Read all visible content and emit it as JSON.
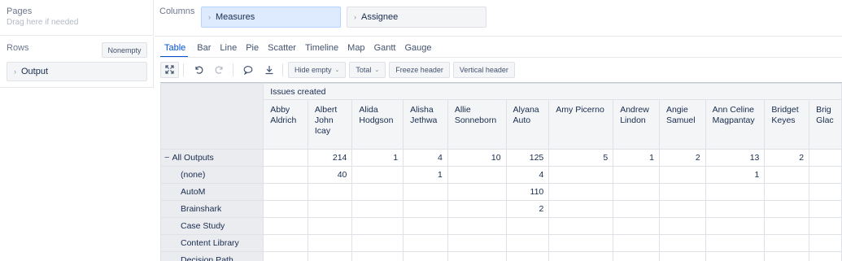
{
  "left": {
    "pages": {
      "title": "Pages",
      "hint": "Drag here if needed"
    },
    "rows": {
      "title": "Rows",
      "nonempty": "Nonempty",
      "chip": "Output"
    }
  },
  "columns": {
    "title": "Columns",
    "chips": [
      "Measures",
      "Assignee"
    ]
  },
  "tabs": [
    "Table",
    "Bar",
    "Line",
    "Pie",
    "Scatter",
    "Timeline",
    "Map",
    "Gantt",
    "Gauge"
  ],
  "active_tab": "Table",
  "toolbar": {
    "icons": [
      "expand-icon",
      "undo-icon",
      "redo-icon",
      "comment-icon",
      "download-icon"
    ],
    "hide_empty": "Hide empty",
    "total": "Total",
    "freeze_header": "Freeze header",
    "vertical_header": "Vertical header"
  },
  "table": {
    "measure": "Issues created",
    "columns": [
      "Abby Aldrich",
      "Albert John Icay",
      "Alida Hodgson",
      "Alisha Jethwa",
      "Allie Sonneborn",
      "Alyana Auto",
      "Amy Picerno",
      "Andrew Lindon",
      "Angie Samuel",
      "Ann Celine Magpantay",
      "Bridget Keyes",
      "Brig Glac"
    ],
    "rows": [
      {
        "label": "All Outputs",
        "values": [
          "",
          "214",
          "1",
          "4",
          "10",
          "125",
          "5",
          "1",
          "2",
          "13",
          "2",
          ""
        ]
      },
      {
        "label": "(none)",
        "values": [
          "",
          "40",
          "",
          "1",
          "",
          "4",
          "",
          "",
          "",
          "1",
          "",
          ""
        ]
      },
      {
        "label": "AutoM",
        "values": [
          "",
          "",
          "",
          "",
          "",
          "110",
          "",
          "",
          "",
          "",
          "",
          ""
        ]
      },
      {
        "label": "Brainshark",
        "values": [
          "",
          "",
          "",
          "",
          "",
          "2",
          "",
          "",
          "",
          "",
          "",
          ""
        ]
      },
      {
        "label": "Case Study",
        "values": [
          "",
          "",
          "",
          "",
          "",
          "",
          "",
          "",
          "",
          "",
          "",
          ""
        ]
      },
      {
        "label": "Content Library",
        "values": [
          "",
          "",
          "",
          "",
          "",
          "",
          "",
          "",
          "",
          "",
          "",
          ""
        ]
      },
      {
        "label": "Decision Path",
        "values": [
          "",
          "",
          "",
          "",
          "",
          "",
          "",
          "",
          "",
          "",
          "",
          ""
        ]
      }
    ]
  }
}
